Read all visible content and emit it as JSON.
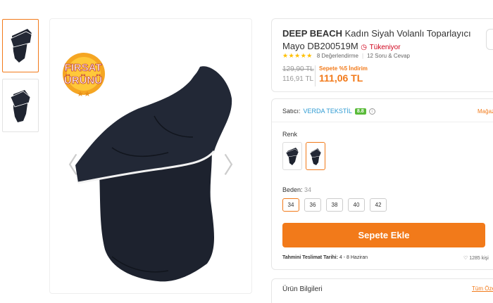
{
  "gallery": {
    "badge_line1": "FIRSAT",
    "badge_line2": "ÜRÜNÜ",
    "prev_arrow": "〈",
    "next_arrow": "〉"
  },
  "product": {
    "brand": "DEEP BEACH",
    "title": "Kadın Siyah Volanlı Toparlayıcı Mayo DB200519M",
    "stock_status": "Tükeniyor",
    "rating_stars": "★★★★★",
    "reviews": "8 Değerlendirme",
    "questions": "12 Soru & Cevap",
    "original_price": "129,90 TL",
    "discounted_price": "116,91 TL",
    "promo_label": "Sepete %5 İndirim",
    "final_price": "111,06 TL"
  },
  "seller": {
    "label": "Satıcı:",
    "name": "VERDA TEKSTİL",
    "score": "8.8",
    "store_link": "Mağaza"
  },
  "options": {
    "color_label": "Renk",
    "size_label": "Beden:",
    "selected_size": "34",
    "sizes": [
      "34",
      "36",
      "38",
      "40",
      "42"
    ]
  },
  "cart": {
    "button_label": "Sepete Ekle",
    "delivery_label": "Tahmini Teslimat Tarihi:",
    "delivery_dates": "4 - 8 Haziran",
    "likes": "1285 kişi"
  },
  "section": {
    "title": "Ürün Bilgileri",
    "link": "Tüm Özellikler"
  },
  "colors": {
    "accent": "#f27a1a",
    "seller_link": "#2d9ad2",
    "score_bg": "#5abb3a",
    "stock_red": "#d0021b"
  }
}
